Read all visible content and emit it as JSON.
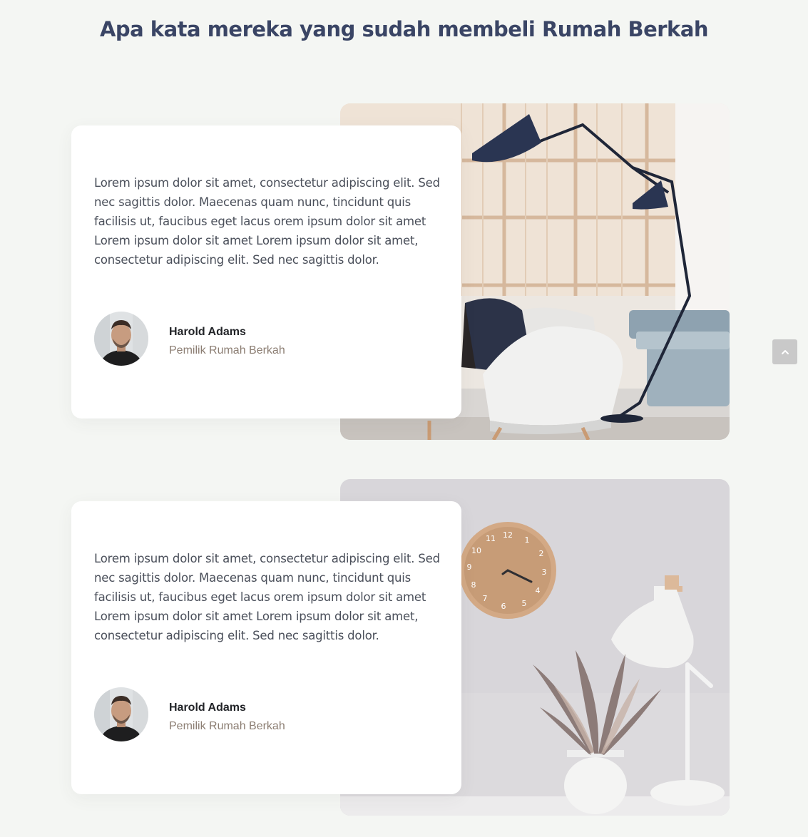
{
  "page": {
    "title": "Apa kata mereka yang sudah membeli Rumah Berkah"
  },
  "testimonials": [
    {
      "quote": "Lorem ipsum dolor sit amet, consectetur adipiscing elit. Sed nec sagittis dolor. Maecenas quam nunc, tincidunt quis facilisis ut, faucibus eget lacus orem ipsum dolor sit amet Lorem ipsum dolor sit amet Lorem ipsum dolor sit amet, consectetur adipiscing elit. Sed nec sagittis dolor.",
      "name": "Harold Adams",
      "role": "Pemilik Rumah Berkah",
      "image_icon": "living-room-lamp-photo"
    },
    {
      "quote": "Lorem ipsum dolor sit amet, consectetur adipiscing elit. Sed nec sagittis dolor. Maecenas quam nunc, tincidunt quis facilisis ut, faucibus eget lacus orem ipsum dolor sit amet Lorem ipsum dolor sit amet Lorem ipsum dolor sit amet, consectetur adipiscing elit. Sed nec sagittis dolor.",
      "name": "Harold Adams",
      "role": "Pemilik Rumah Berkah",
      "image_icon": "clock-plant-lamp-photo"
    }
  ],
  "scroll_top": {
    "icon": "chevron-up-icon"
  },
  "colors": {
    "background": "#f4f6f3",
    "title": "#3a4565",
    "quote_text": "#4a4f5a",
    "role_text": "#8b7d72",
    "scroll_button": "#c9c9c9"
  }
}
